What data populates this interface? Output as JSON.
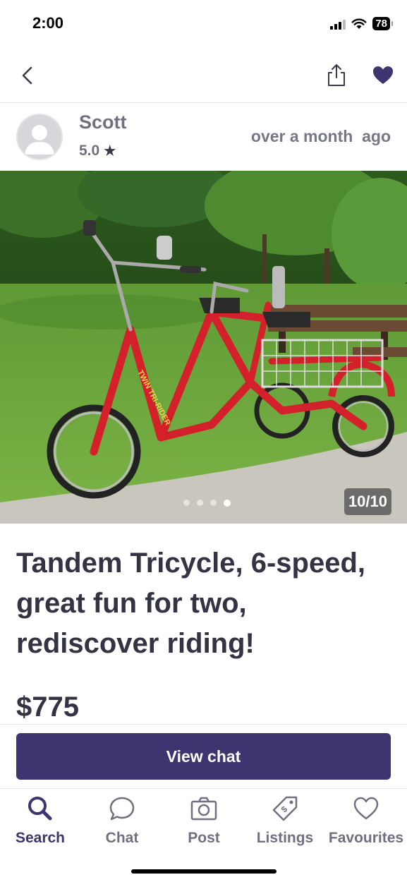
{
  "status_bar": {
    "time": "2:00",
    "battery": "78"
  },
  "nav": {
    "back_icon": "chevron-left-icon",
    "share_icon": "share-icon",
    "favourite_icon": "heart-filled-icon",
    "accent": "#3d3470"
  },
  "seller": {
    "name": "Scott",
    "rating": "5.0",
    "posted": "over a month  ago"
  },
  "photo": {
    "counter": "10/10",
    "dots": 4,
    "active_dot": 4,
    "frame_label": "TWIN TRI-RIDER"
  },
  "listing": {
    "title": "Tandem Tricycle, 6-speed, great fun for two, rediscover riding!",
    "price": "$775"
  },
  "actions": {
    "view_chat": "View chat",
    "button_color": "#3d3470"
  },
  "tabs": [
    {
      "label": "Search",
      "icon": "search-icon",
      "active": true
    },
    {
      "label": "Chat",
      "icon": "chat-bubble-icon",
      "active": false
    },
    {
      "label": "Post",
      "icon": "camera-icon",
      "active": false
    },
    {
      "label": "Listings",
      "icon": "price-tag-icon",
      "active": false
    },
    {
      "label": "Favourites",
      "icon": "heart-outline-icon",
      "active": false
    }
  ]
}
